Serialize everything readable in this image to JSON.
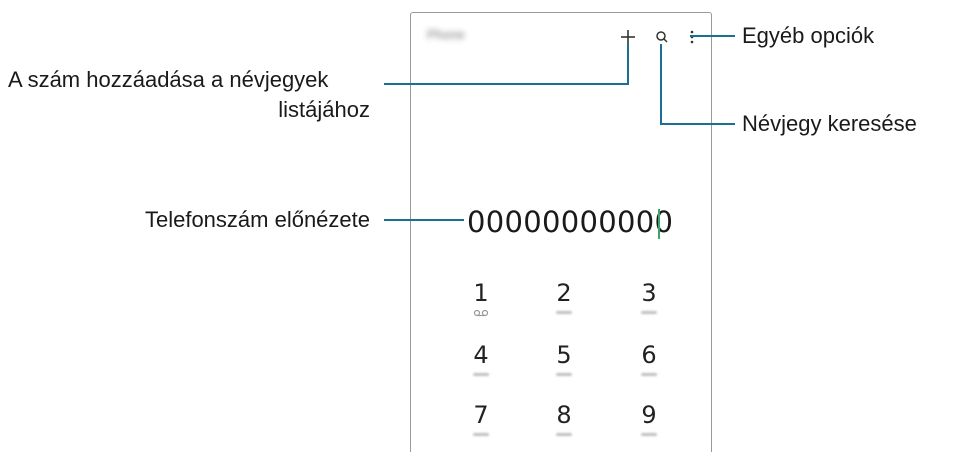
{
  "screen": {
    "app_title": "Phone",
    "icons": [
      "plus-icon",
      "search-icon",
      "more-options-icon"
    ],
    "phone_number": "00000000000"
  },
  "keypad": [
    {
      "digit": "1",
      "sub": "voicemail-icon"
    },
    {
      "digit": "2",
      "sub": "ABC"
    },
    {
      "digit": "3",
      "sub": "DEF"
    },
    {
      "digit": "4",
      "sub": "GHI"
    },
    {
      "digit": "5",
      "sub": "JKL"
    },
    {
      "digit": "6",
      "sub": "MNO"
    },
    {
      "digit": "7",
      "sub": "PQRS"
    },
    {
      "digit": "8",
      "sub": "TUV"
    },
    {
      "digit": "9",
      "sub": "WXYZ"
    }
  ],
  "callouts": {
    "more_options": "Egyéb opciók",
    "add_contact_line1": "A szám hozzáadása a névjegyek",
    "add_contact_line2": "listájához",
    "search_contact": "Névjegy keresése",
    "number_preview": "Telefonszám előnézete"
  },
  "colors": {
    "leader_line": "#1a6f96",
    "caret": "#3aa564"
  }
}
